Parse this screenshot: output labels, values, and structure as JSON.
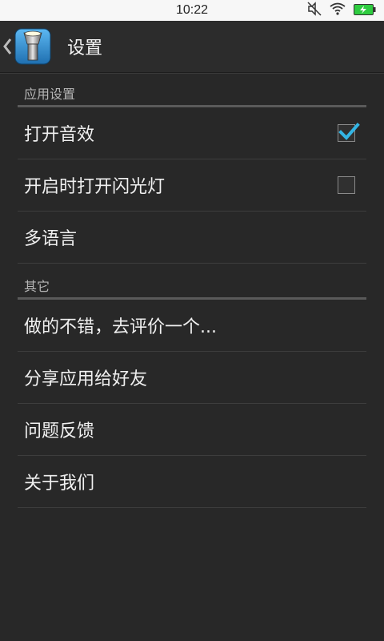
{
  "status_bar": {
    "time": "10:22",
    "icons": [
      "mute-icon",
      "wifi-icon",
      "battery-charging-icon"
    ],
    "battery_color": "#2ecc40"
  },
  "action_bar": {
    "title": "设置",
    "back_icon": "chevron-left-icon",
    "app_icon": "flashlight-app-icon"
  },
  "sections": [
    {
      "header": "应用设置",
      "items": [
        {
          "label": "打开音效",
          "checkbox": true,
          "checked": true
        },
        {
          "label": "开启时打开闪光灯",
          "checkbox": true,
          "checked": false
        },
        {
          "label": "多语言",
          "checkbox": false
        }
      ]
    },
    {
      "header": "其它",
      "items": [
        {
          "label": "做的不错，去评价一个..."
        },
        {
          "label": "分享应用给好友"
        },
        {
          "label": "问题反馈"
        },
        {
          "label": "关于我们"
        }
      ]
    }
  ],
  "colors": {
    "background": "#282828",
    "check_accent": "#33b5e5"
  }
}
